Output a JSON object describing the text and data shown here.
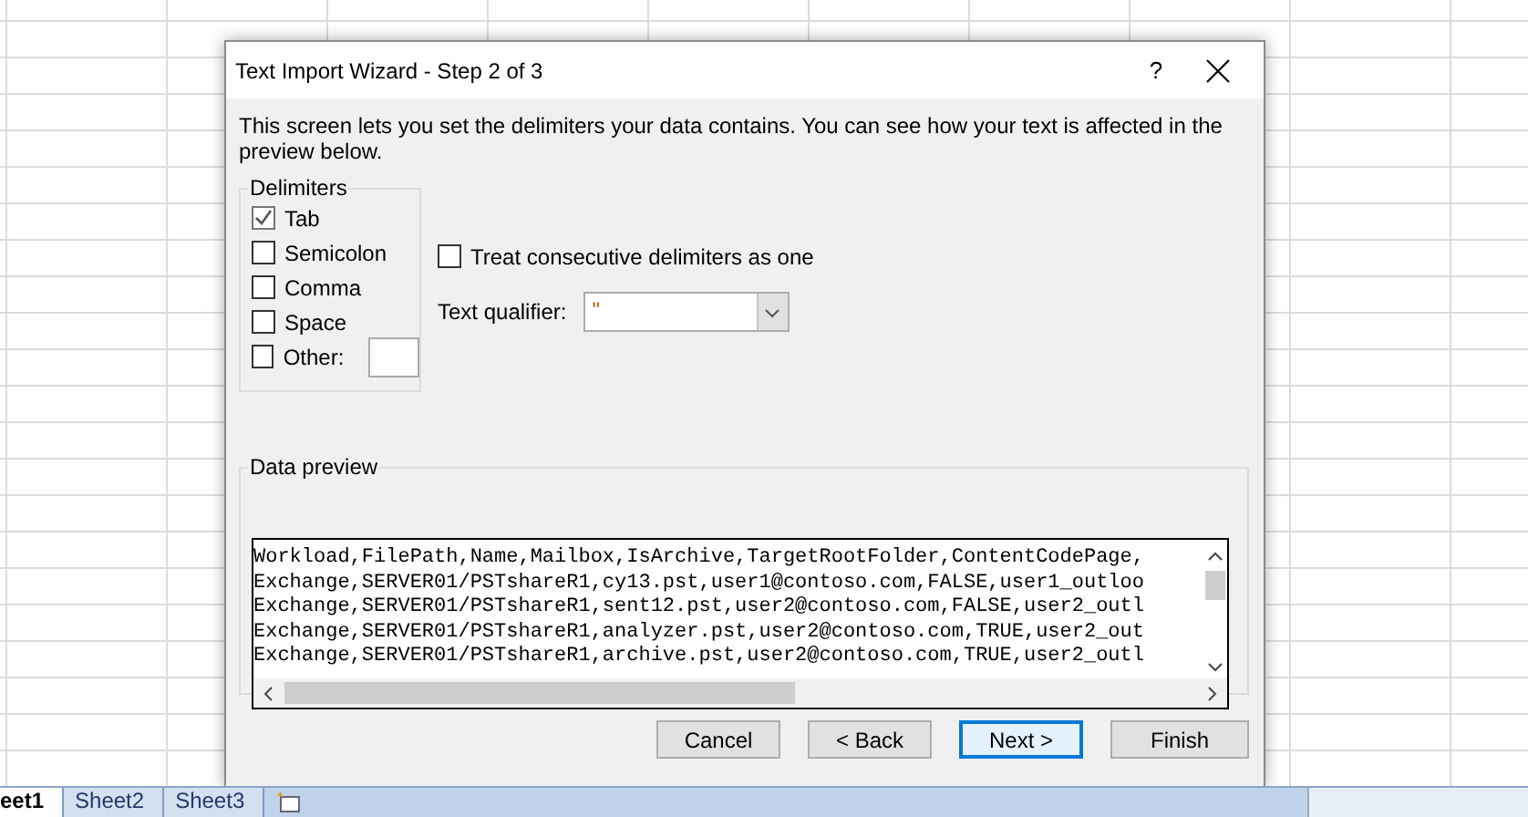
{
  "window": {
    "title": "Text Import Wizard - Step 2 of 3",
    "help": "?"
  },
  "description": "This screen lets you set the delimiters your data contains.  You can see how your text is affected in the preview below.",
  "delimiters": {
    "label": "Delimiters",
    "items": [
      {
        "label": "Tab",
        "checked": true,
        "kind": "plain"
      },
      {
        "label": "Semicolon",
        "checked": false,
        "kind": "plain"
      },
      {
        "label": "Comma",
        "checked": false,
        "kind": "plain"
      },
      {
        "label": "Space",
        "checked": false,
        "kind": "plain"
      },
      {
        "label": "Other:",
        "checked": false,
        "kind": "with_field"
      }
    ]
  },
  "consecutive": {
    "label": "Treat consecutive delimiters as one",
    "checked": false
  },
  "text_qualifier": {
    "label": "Text qualifier:",
    "value": "\""
  },
  "data_preview": {
    "label": "Data preview",
    "lines": [
      "Workload,FilePath,Name,Mailbox,IsArchive,TargetRootFolder,ContentCodePage,",
      "Exchange,SERVER01/PSTshareR1,cy13.pst,user1@contoso.com,FALSE,user1_outloo",
      "Exchange,SERVER01/PSTshareR1,sent12.pst,user2@contoso.com,FALSE,user2_outl",
      "Exchange,SERVER01/PSTshareR1,analyzer.pst,user2@contoso.com,TRUE,user2_out",
      "Exchange,SERVER01/PSTshareR1,archive.pst,user2@contoso.com,TRUE,user2_outl"
    ]
  },
  "buttons": [
    {
      "label": "Cancel",
      "focused": false
    },
    {
      "label": "< Back",
      "focused": false
    },
    {
      "label": "Next >",
      "focused": true
    },
    {
      "label": "Finish",
      "focused": false
    }
  ],
  "sheet_tabs": [
    {
      "label": "eet1",
      "selected": true
    },
    {
      "label": "Sheet2",
      "selected": false
    },
    {
      "label": "Sheet3",
      "selected": false
    }
  ]
}
